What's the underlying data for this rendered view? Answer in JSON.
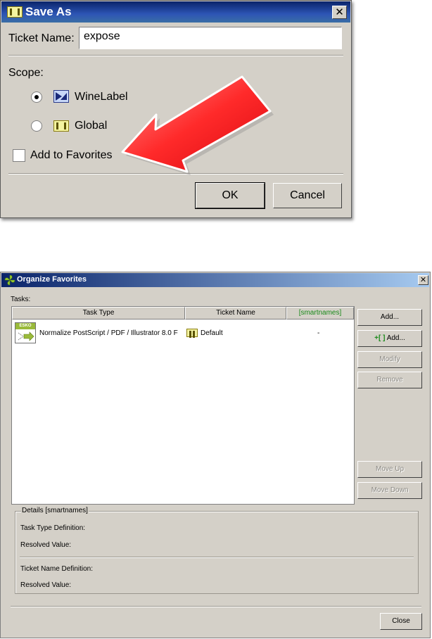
{
  "save_as": {
    "title": "Save As",
    "close_glyph": "✕",
    "ticket_name_label": "Ticket Name:",
    "ticket_name_value": "expose",
    "scope_label": "Scope:",
    "scope_options": [
      {
        "label": "WineLabel",
        "selected": true
      },
      {
        "label": "Global",
        "selected": false
      }
    ],
    "add_to_favorites_label": "Add to Favorites",
    "add_to_favorites_checked": false,
    "ok_label": "OK",
    "cancel_label": "Cancel"
  },
  "organize": {
    "title": "Organize Favorites",
    "close_glyph": "✕",
    "tasks_label": "Tasks:",
    "columns": [
      "Task Type",
      "Ticket Name",
      "[smartnames]"
    ],
    "rows": [
      {
        "icon_badge": "ESKO",
        "task_type": "Normalize PostScript / PDF / Illustrator 8.0 F",
        "ticket_name": "Default",
        "smartnames": "-"
      }
    ],
    "buttons": {
      "add": "Add...",
      "add_smart_prefix": "+[ ]",
      "add_smart": "Add...",
      "modify": "Modify",
      "remove": "Remove",
      "move_up": "Move Up",
      "move_down": "Move Down",
      "close": "Close"
    },
    "details": {
      "legend": "Details [smartnames]",
      "task_type_definition": "Task Type Definition:",
      "resolved_value_1": "Resolved Value:",
      "ticket_name_definition": "Ticket Name Definition:",
      "resolved_value_2": "Resolved Value:"
    }
  },
  "colors": {
    "dialog_bg": "#d4d0c8",
    "title_blue": "#0a246a",
    "arrow_red": "#e8141c",
    "smartnames_green": "#1a8a1a"
  }
}
